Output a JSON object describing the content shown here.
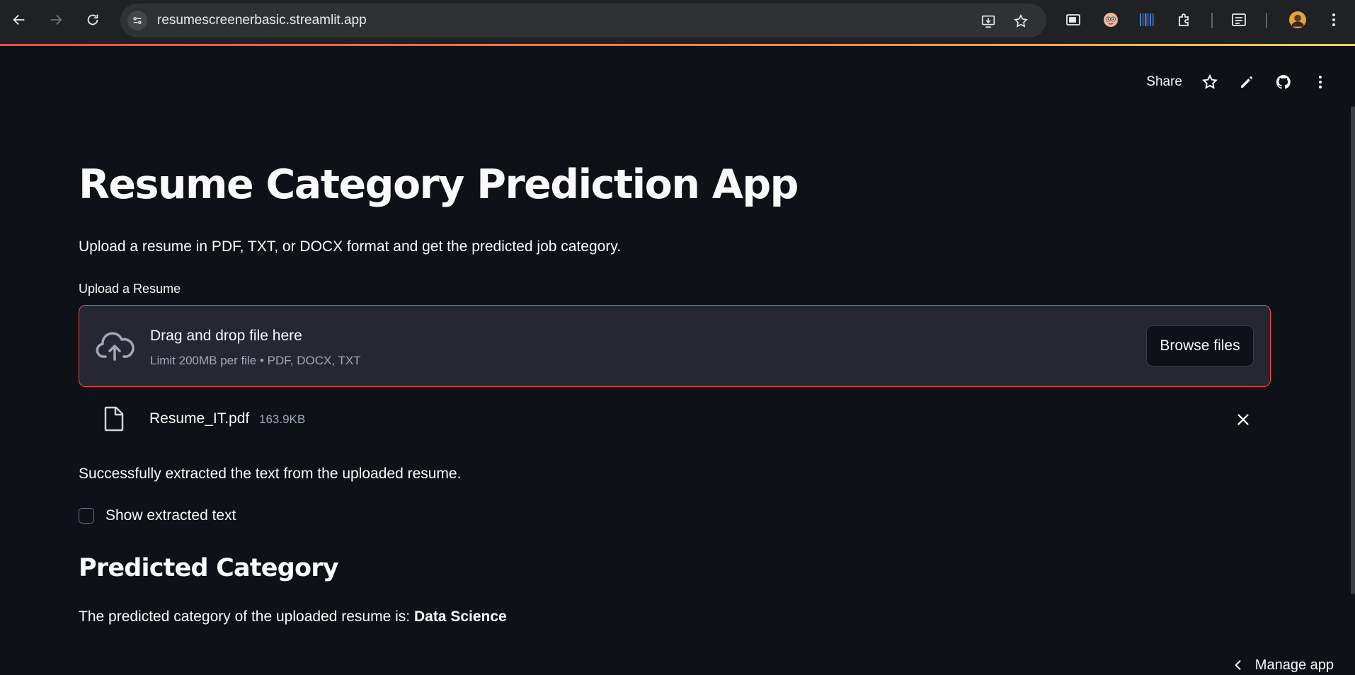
{
  "browser": {
    "url": "resumescreenerbasic.streamlit.app",
    "icons": [
      "back-arrow-icon",
      "forward-arrow-icon",
      "reload-icon",
      "site-info-icon",
      "install-app-icon",
      "bookmark-star-icon",
      "picture-in-picture-icon",
      "extension-face-icon",
      "extension-barcode-icon",
      "extensions-puzzle-icon",
      "reading-list-icon",
      "profile-avatar",
      "chrome-menu-icon"
    ]
  },
  "toolbar": {
    "share_label": "Share",
    "icons": [
      "star-icon",
      "edit-pencil-icon",
      "github-icon",
      "more-vertical-icon"
    ]
  },
  "app": {
    "title": "Resume Category Prediction App",
    "subtitle": "Upload a resume in PDF, TXT, or DOCX format and get the predicted job category.",
    "uploader": {
      "label": "Upload a Resume",
      "dropzone_title": "Drag and drop file here",
      "dropzone_subtitle": "Limit 200MB per file • PDF, DOCX, TXT",
      "browse_label": "Browse files",
      "file": {
        "name": "Resume_IT.pdf",
        "size": "163.9KB"
      }
    },
    "success_message": "Successfully extracted the text from the uploaded resume.",
    "checkbox": {
      "label": "Show extracted text",
      "checked": false
    },
    "result": {
      "heading": "Predicted Category",
      "prefix": "The predicted category of the uploaded resume is:",
      "value": "Data Science"
    },
    "manage_app_label": "Manage app"
  },
  "colors": {
    "background": "#0e1117",
    "dropzone_bg": "#262730",
    "accent": "#ff4b4b",
    "muted_text": "#a3a8b8",
    "chrome_bg": "#202124"
  }
}
